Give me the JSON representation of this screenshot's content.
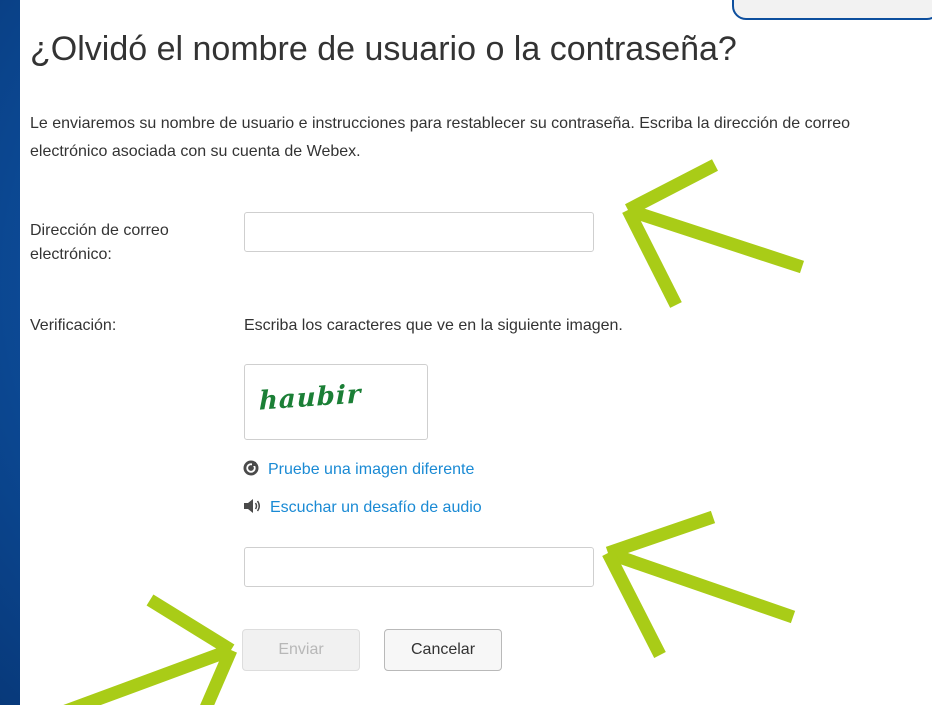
{
  "page": {
    "title": "¿Olvidó el nombre de usuario o la contraseña?",
    "intro": "Le enviaremos su nombre de usuario e instrucciones para restablecer su contraseña. Escriba la dirección de correo electrónico asociada con su cuenta de Webex."
  },
  "form": {
    "email_label": "Dirección de correo electrónico:",
    "email_value": "",
    "verification_label": "Verificación:",
    "captcha_instructions": "Escriba los caracteres que ve en la siguiente imagen.",
    "captcha_image_text": "haubir",
    "new_image_link": "Pruebe una imagen diferente",
    "audio_link": "Escuchar un desafío de audio",
    "captcha_value": "",
    "send_label": "Enviar",
    "cancel_label": "Cancelar"
  },
  "colors": {
    "background": "#0d4f9e",
    "link": "#1a8ad4",
    "arrow": "#a9cc17",
    "captcha": "#1b7f36"
  },
  "icons": {
    "refresh": "refresh-icon",
    "audio": "speaker-icon"
  }
}
